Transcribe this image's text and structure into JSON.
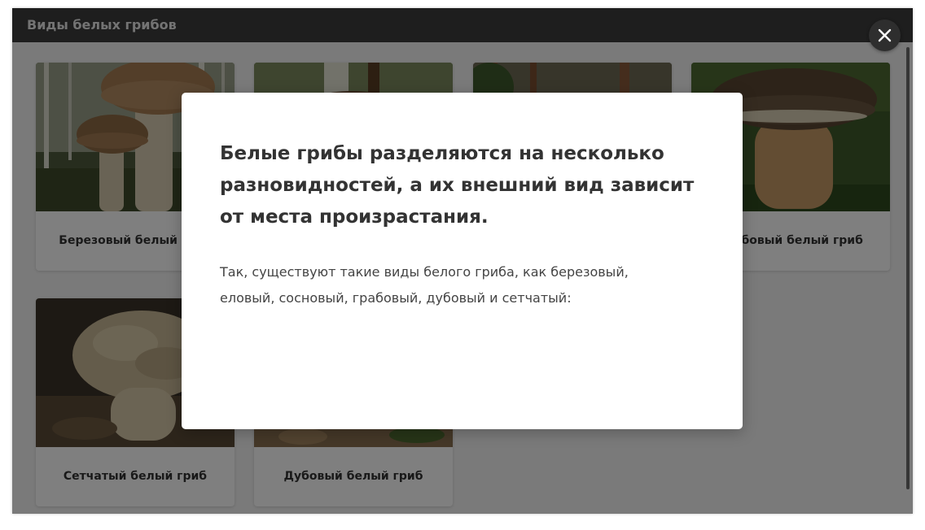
{
  "window": {
    "title": "Виды белых грибов"
  },
  "gallery": {
    "items": [
      {
        "label": "Березовый белый гриб",
        "image_icon": "birch-bolete-photo"
      },
      {
        "label": "",
        "image_icon": "spruce-bolete-photo"
      },
      {
        "label": "",
        "image_icon": "pine-bolete-photo"
      },
      {
        "label": "Грабовый белый гриб",
        "image_icon": "hornbeam-bolete-photo"
      },
      {
        "label": "Сетчатый белый гриб",
        "image_icon": "reticulated-bolete-photo"
      },
      {
        "label": "Дубовый белый гриб",
        "image_icon": "oak-bolete-photo"
      }
    ]
  },
  "modal": {
    "title": "Белые грибы разделяются на несколько разновидностей, а их внешний вид зависит от места произрастания.",
    "text": "Так, существуют такие виды белого гриба, как березовый, еловый, сосновый, грабовый, дубовый и сетчатый:"
  },
  "close_button": {
    "icon": "close-icon"
  },
  "colors": {
    "titlebar": "#3c3c3c",
    "overlay": "rgba(0,0,0,0.5)",
    "modal_bg": "#ffffff",
    "close_bg": "#2e2e2e"
  }
}
